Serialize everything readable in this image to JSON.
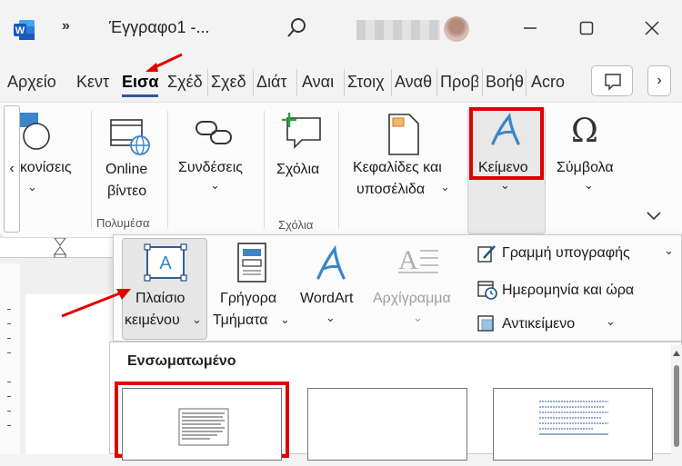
{
  "titlebar": {
    "doc_title": "Έγγραφο1  -...",
    "overflow": "»"
  },
  "tabs": [
    {
      "label": "Αρχείο"
    },
    {
      "label": "Κεντ"
    },
    {
      "label": "Εισα"
    },
    {
      "label": "Σχέδ"
    },
    {
      "label": "Σχεδ"
    },
    {
      "label": "Διάτ"
    },
    {
      "label": "Αναι"
    },
    {
      "label": "Στοιχ"
    },
    {
      "label": "Αναθ"
    },
    {
      "label": "Προβ"
    },
    {
      "label": "Βοήθ"
    },
    {
      "label": "Acro"
    }
  ],
  "ribbon": {
    "shapes_label": "κονίσεις",
    "online_video_line1": "Online",
    "online_video_line2": "βίντεο",
    "media_group": "Πολυμέσα",
    "links_label": "Συνδέσεις",
    "comment_label": "Σχόλια",
    "comments_group": "Σχόλια",
    "header_footer_line1": "Κεφαλίδες και",
    "header_footer_line2": "υποσέλιδα",
    "text_label": "Κείμενο",
    "symbols_label": "Σύμβολα"
  },
  "dropdown": {
    "textbox_line1": "Πλαίσιο",
    "textbox_line2": "κειμένου",
    "quickparts_line1": "Γρήγορα",
    "quickparts_line2": "Τμήματα",
    "wordart_label": "WordArt",
    "dropcap_label": "Αρχίγραμμα",
    "signature_line": "Γραμμή υπογραφής",
    "date_time": "Ημερομηνία και ώρα",
    "object": "Αντικείμενο"
  },
  "gallery": {
    "title": "Ενσωματωμένο"
  },
  "colors": {
    "accent": "#2b579a",
    "highlight_red": "#e00000",
    "icon_blue": "#3a86c8"
  }
}
